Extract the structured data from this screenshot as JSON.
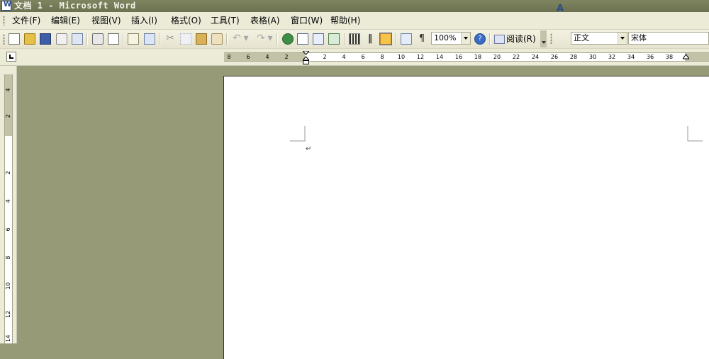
{
  "window": {
    "title": "文档 1 - Microsoft Word",
    "icon": "word-app-icon"
  },
  "menubar": {
    "items": [
      {
        "label": "文件(F)"
      },
      {
        "label": "编辑(E)"
      },
      {
        "label": "视图(V)"
      },
      {
        "label": "插入(I)"
      },
      {
        "label": "格式(O)"
      },
      {
        "label": "工具(T)"
      },
      {
        "label": "表格(A)"
      },
      {
        "label": "窗口(W)"
      },
      {
        "label": "帮助(H)"
      }
    ]
  },
  "toolbar": {
    "zoom": "100%",
    "read_label": "阅读(R)",
    "style_value": "正文",
    "font_value": "宋体",
    "styles_icon_glyph": "A"
  },
  "ruler": {
    "horizontal_left_labels": [
      "8",
      "6",
      "4",
      "2"
    ],
    "horizontal_right_labels": [
      "2",
      "4",
      "6",
      "8",
      "10",
      "12",
      "14",
      "16",
      "18",
      "20",
      "22",
      "24",
      "26",
      "28",
      "30",
      "32",
      "34",
      "36",
      "38"
    ],
    "vertical_top_labels": [
      "4",
      "2"
    ],
    "vertical_labels": [
      "2",
      "4",
      "6",
      "8",
      "10",
      "12",
      "14"
    ]
  },
  "document": {
    "paragraph_mark": "↵"
  },
  "colors": {
    "workspace": "#969a76",
    "toolbar_bg": "#ecebd8",
    "titlebar": "#7f8460",
    "page": "#ffffff"
  }
}
